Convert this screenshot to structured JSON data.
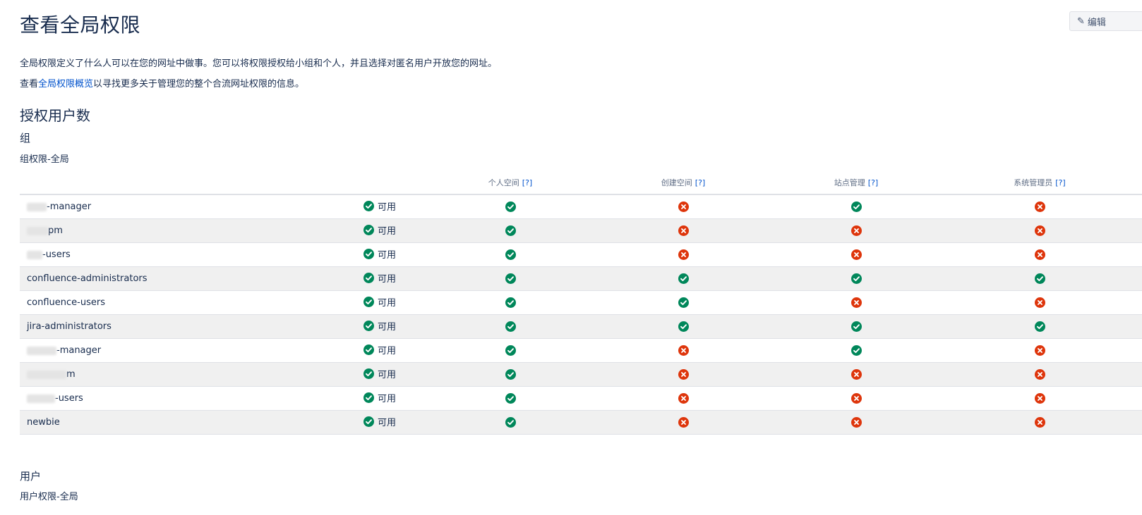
{
  "header": {
    "title": "查看全局权限",
    "edit_label": "编辑"
  },
  "intro": {
    "line1": "全局权限定义了什么人可以在您的网址中做事。您可以将权限授权给小组和个人，并且选择对匿名用户开放您的网址。",
    "line2_prefix": "查看",
    "line2_link": "全局权限概览",
    "line2_suffix": "以寻找更多关于管理您的整个合流网址权限的信息。"
  },
  "section_title": "授权用户数",
  "groups": {
    "heading": "组",
    "caption": "组权限-全局",
    "columns": [
      "个人空间",
      "创建空间",
      "站点管理",
      "系统管理员"
    ],
    "help_label": "[?]",
    "rows": [
      {
        "name": "-manager",
        "status": "可用",
        "perms": [
          true,
          false,
          true,
          false
        ]
      },
      {
        "name": "pm",
        "status": "可用",
        "perms": [
          true,
          false,
          false,
          false
        ]
      },
      {
        "name": "-users",
        "status": "可用",
        "perms": [
          true,
          false,
          false,
          false
        ]
      },
      {
        "name": "confluence-administrators",
        "status": "可用",
        "perms": [
          true,
          true,
          true,
          true
        ]
      },
      {
        "name": "confluence-users",
        "status": "可用",
        "perms": [
          true,
          true,
          false,
          false
        ]
      },
      {
        "name": "jira-administrators",
        "status": "可用",
        "perms": [
          true,
          true,
          true,
          true
        ]
      },
      {
        "name": "-manager",
        "status": "可用",
        "perms": [
          true,
          false,
          true,
          false
        ]
      },
      {
        "name": "m",
        "status": "可用",
        "perms": [
          true,
          false,
          false,
          false
        ]
      },
      {
        "name": "-users",
        "status": "可用",
        "perms": [
          true,
          false,
          false,
          false
        ]
      },
      {
        "name": "newbie",
        "status": "可用",
        "perms": [
          true,
          false,
          false,
          false
        ]
      }
    ]
  },
  "users": {
    "heading": "用户",
    "caption": "用户权限-全局"
  },
  "icons": {
    "granted": "check-circle-icon",
    "denied": "cross-circle-icon",
    "edit": "pencil-icon"
  },
  "colors": {
    "granted": "#00875a",
    "denied": "#de350b",
    "link": "#0052cc",
    "row_alt": "#f0f0f0"
  }
}
